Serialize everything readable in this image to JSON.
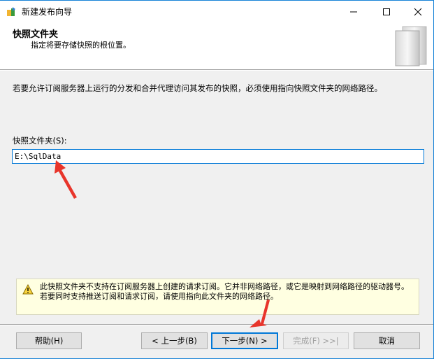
{
  "window": {
    "title": "新建发布向导"
  },
  "header": {
    "title": "快照文件夹",
    "subtitle": "指定将要存储快照的根位置。"
  },
  "main": {
    "description": "若要允许订阅服务器上运行的分发和合并代理访问其发布的快照，必须使用指向快照文件夹的网络路径。",
    "snapshot_folder_label": "快照文件夹(S):",
    "snapshot_folder_value": "E:\\SqlData"
  },
  "warning": {
    "text": "此快照文件夹不支持在订阅服务器上创建的请求订阅。它并非网络路径，或它是映射到网络路径的驱动器号。若要同时支持推送订阅和请求订阅，请使用指向此文件夹的网络路径。"
  },
  "buttons": {
    "help": "帮助(H)",
    "prev": "< 上一步(B)",
    "next": "下一步(N) >",
    "finish": "完成(F) >>|",
    "cancel": "取消"
  },
  "colors": {
    "accent": "#0078d7",
    "warning_bg": "#ffffe1",
    "annotation": "#e8352b"
  }
}
